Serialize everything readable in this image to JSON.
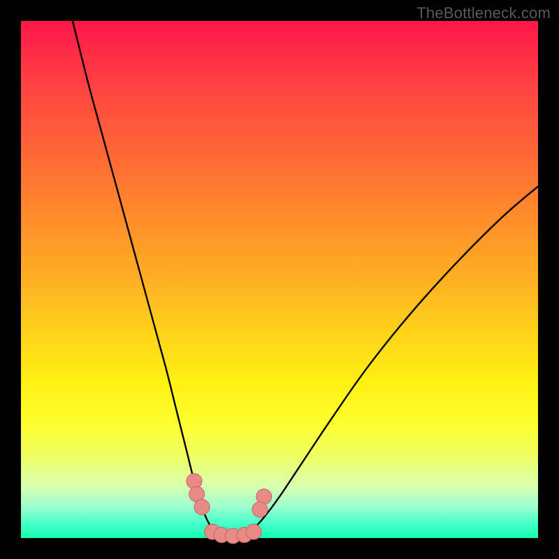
{
  "watermark": "TheBottleneck.com",
  "colors": {
    "frame": "#000000",
    "curve": "#000000",
    "marker_fill": "#e88a86",
    "marker_stroke": "#c9625f"
  },
  "chart_data": {
    "type": "line",
    "title": "",
    "xlabel": "",
    "ylabel": "",
    "xlim": [
      0,
      100
    ],
    "ylim": [
      0,
      100
    ],
    "grid": false,
    "series": [
      {
        "name": "left-branch",
        "x": [
          10,
          13,
          16,
          19,
          22,
          25,
          28,
          30,
          32,
          33.5,
          35,
          36,
          37,
          38
        ],
        "y": [
          100,
          88,
          77,
          66,
          55,
          44,
          33,
          25,
          17,
          11,
          6,
          3.5,
          1.8,
          0.7
        ]
      },
      {
        "name": "right-branch",
        "x": [
          44,
          45,
          47,
          50,
          54,
          60,
          67,
          75,
          84,
          93,
          100
        ],
        "y": [
          0.7,
          1.8,
          4,
          8,
          14,
          23,
          33,
          43,
          53,
          62,
          68
        ]
      },
      {
        "name": "floor",
        "x": [
          38,
          40,
          42,
          44
        ],
        "y": [
          0.5,
          0.3,
          0.3,
          0.5
        ]
      }
    ],
    "markers": [
      {
        "name": "left-cluster-top",
        "x": 33.5,
        "y": 11
      },
      {
        "name": "left-cluster-mid",
        "x": 34.0,
        "y": 8.5
      },
      {
        "name": "left-cluster-low",
        "x": 35.0,
        "y": 6
      },
      {
        "name": "right-cluster-top",
        "x": 47.0,
        "y": 8
      },
      {
        "name": "right-cluster-low",
        "x": 46.2,
        "y": 5.5
      },
      {
        "name": "floor-a",
        "x": 37.0,
        "y": 1.2
      },
      {
        "name": "floor-b",
        "x": 38.8,
        "y": 0.6
      },
      {
        "name": "floor-c",
        "x": 41.0,
        "y": 0.4
      },
      {
        "name": "floor-d",
        "x": 43.2,
        "y": 0.6
      },
      {
        "name": "floor-e",
        "x": 45.0,
        "y": 1.2
      }
    ]
  }
}
